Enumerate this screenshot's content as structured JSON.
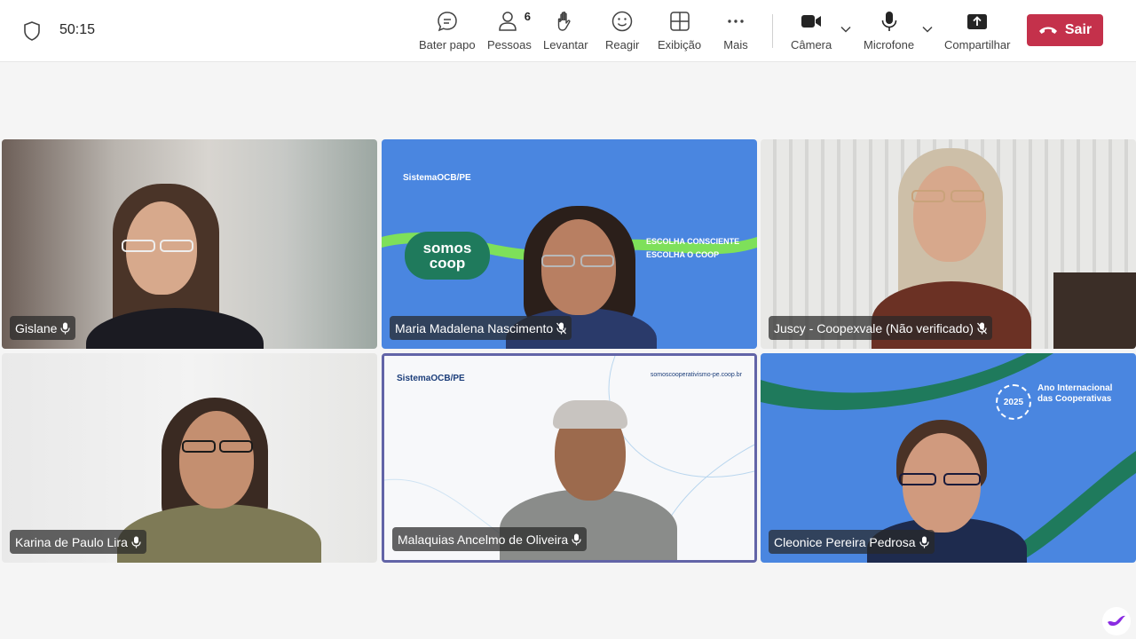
{
  "meeting": {
    "timer": "50:15"
  },
  "toolbar": {
    "chat_label": "Bater papo",
    "people_label": "Pessoas",
    "people_count": "6",
    "raise_label": "Levantar",
    "react_label": "Reagir",
    "view_label": "Exibição",
    "more_label": "Mais",
    "camera_label": "Câmera",
    "mic_label": "Microfone",
    "share_label": "Compartilhar",
    "leave_label": "Sair"
  },
  "participants": [
    {
      "name": "Gislane"
    },
    {
      "name": "Maria Madalena Nascimento"
    },
    {
      "name": "Juscy - Coopexvale (Não verificado)"
    },
    {
      "name": "Karina de Paulo Lira"
    },
    {
      "name": "Malaquias Ancelmo de Oliveira"
    },
    {
      "name": "Cleonice Pereira Pedrosa"
    }
  ],
  "backgrounds": {
    "ocb_logo": "SistemaOCB/PE",
    "somos_coop": "somos coop",
    "choice_line1": "ESCOLHA CONSCIENTE",
    "choice_line2": "ESCOLHA O COOP",
    "site": "somoscooperativismo-pe.coop.br",
    "year_title": "Ano Internacional das Cooperativas",
    "year": "2025"
  },
  "colors": {
    "leave": "#c4314b",
    "active_border": "#6264a7",
    "coop_blue": "#4a86e0",
    "coop_green": "#1f7a5c"
  }
}
